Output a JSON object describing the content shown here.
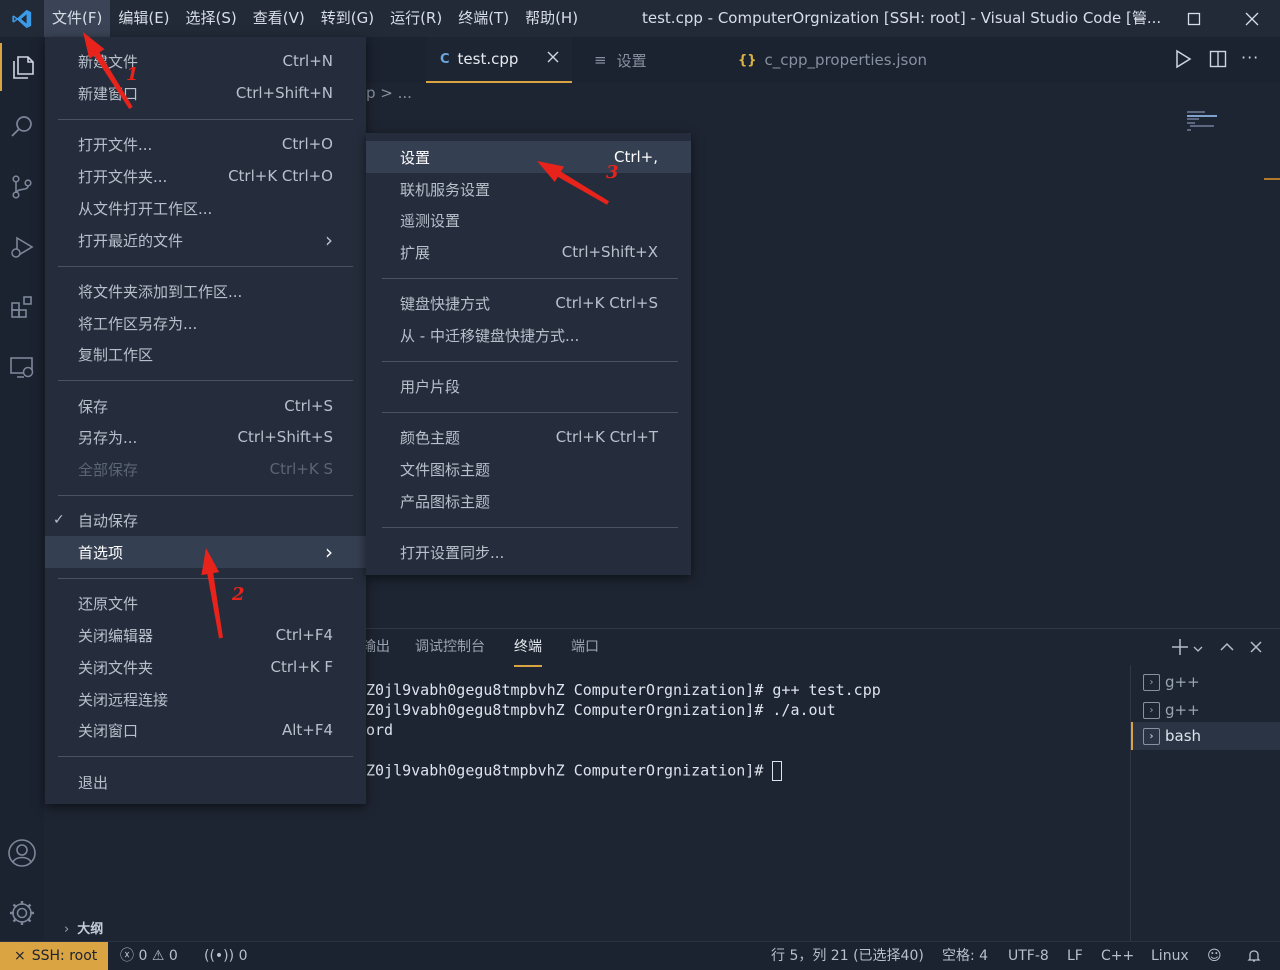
{
  "menubar": [
    "文件(F)",
    "编辑(E)",
    "选择(S)",
    "查看(V)",
    "转到(G)",
    "运行(R)",
    "终端(T)",
    "帮助(H)"
  ],
  "window_title": "test.cpp - ComputerOrgnization [SSH: root] - Visual Studio Code [管...",
  "tabs": [
    {
      "label": "test.cpp",
      "icon": "C",
      "active": true
    },
    {
      "label": "设置",
      "icon": "≡"
    },
    {
      "label": "c_cpp_properties.json",
      "icon": "{}"
    }
  ],
  "breadcrumb": "p > ...",
  "file_menu": [
    {
      "label": "新建文件",
      "kb": "Ctrl+N"
    },
    {
      "label": "新建窗口",
      "kb": "Ctrl+Shift+N"
    },
    {
      "label": "打开文件...",
      "kb": "Ctrl+O"
    },
    {
      "label": "打开文件夹...",
      "kb": "Ctrl+K Ctrl+O"
    },
    {
      "label": "从文件打开工作区...",
      "kb": ""
    },
    {
      "label": "打开最近的文件",
      "kb": "›"
    },
    {
      "label": "将文件夹添加到工作区...",
      "kb": ""
    },
    {
      "label": "将工作区另存为...",
      "kb": ""
    },
    {
      "label": "复制工作区",
      "kb": ""
    },
    {
      "label": "保存",
      "kb": "Ctrl+S"
    },
    {
      "label": "另存为...",
      "kb": "Ctrl+Shift+S"
    },
    {
      "label": "全部保存",
      "kb": "Ctrl+K S"
    },
    {
      "label": "自动保存",
      "kb": "",
      "check": "✓"
    },
    {
      "label": "首选项",
      "kb": "›"
    },
    {
      "label": "还原文件",
      "kb": ""
    },
    {
      "label": "关闭编辑器",
      "kb": "Ctrl+F4"
    },
    {
      "label": "关闭文件夹",
      "kb": "Ctrl+K F"
    },
    {
      "label": "关闭远程连接",
      "kb": ""
    },
    {
      "label": "关闭窗口",
      "kb": "Alt+F4"
    },
    {
      "label": "退出",
      "kb": ""
    }
  ],
  "pref_menu": [
    {
      "label": "设置",
      "kb": "Ctrl+,"
    },
    {
      "label": "联机服务设置",
      "kb": ""
    },
    {
      "label": "遥测设置",
      "kb": ""
    },
    {
      "label": "扩展",
      "kb": "Ctrl+Shift+X"
    },
    {
      "label": "键盘快捷方式",
      "kb": "Ctrl+K Ctrl+S"
    },
    {
      "label": "从 - 中迁移键盘快捷方式...",
      "kb": ""
    },
    {
      "label": "用户片段",
      "kb": ""
    },
    {
      "label": "颜色主题",
      "kb": "Ctrl+K Ctrl+T"
    },
    {
      "label": "文件图标主题",
      "kb": ""
    },
    {
      "label": "产品图标主题",
      "kb": ""
    },
    {
      "label": "打开设置同步...",
      "kb": ""
    }
  ],
  "panel_tabs": [
    "输出",
    "调试控制台",
    "终端",
    "端口"
  ],
  "terminal_lines": [
    "Z0jl9vabh0gegu8tmpbvhZ ComputerOrgnization]# g++ test.cpp",
    "Z0jl9vabh0gegu8tmpbvhZ ComputerOrgnization]# ./a.out",
    "ord",
    "",
    "Z0jl9vabh0gegu8tmpbvhZ ComputerOrgnization]# "
  ],
  "terminals": [
    "g++",
    "g++",
    "bash"
  ],
  "outline_label": "大纲",
  "status": {
    "remote": "SSH: root",
    "errors": "0",
    "warnings": "0",
    "ports": "0",
    "position": "行 5，列 21 (已选择40)",
    "spaces": "空格: 4",
    "encoding": "UTF-8",
    "eol": "LF",
    "language": "C++",
    "os": "Linux"
  },
  "annotations": [
    "1",
    "2",
    "3"
  ]
}
